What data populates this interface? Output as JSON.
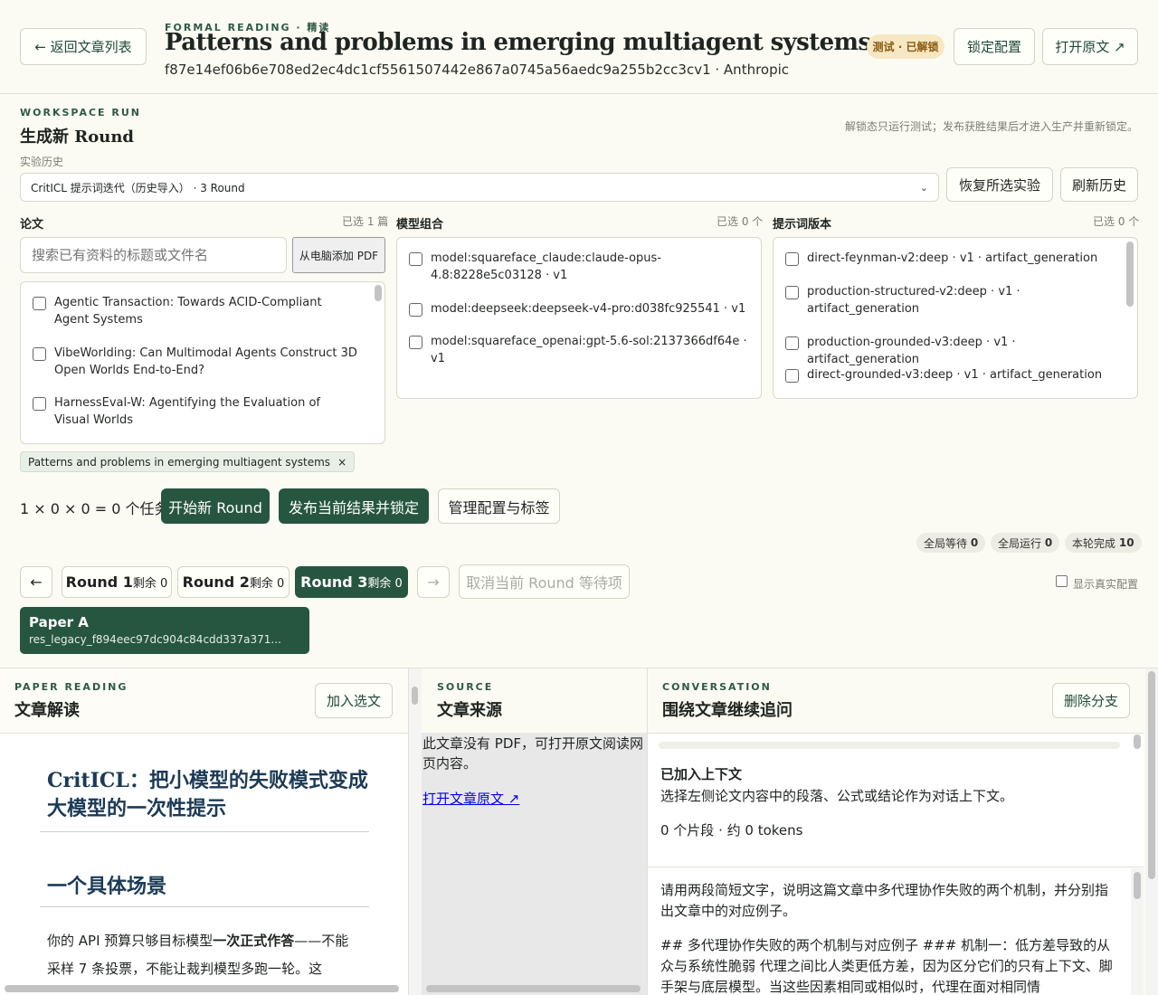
{
  "header": {
    "back_label": "← 返回文章列表",
    "eyebrow": "FORMAL READING · 精读",
    "title": "Patterns and problems in emerging multiagent systems",
    "subtitle": "f87e14ef06b6e708ed2ec4dc1cf5561507442e867a0745a56aedc9a255b2cc3cv1 · Anthropic",
    "status_badge": "测试 · 已解锁",
    "lock_label": "锁定配置",
    "open_label": "打开原文 ↗"
  },
  "workspace": {
    "eyebrow": "WORKSPACE RUN",
    "title": "生成新 Round",
    "note": "解锁态只运行测试；发布获胜结果后才进入生产并重新锁定。",
    "history_label": "实验历史",
    "history_selected": "CritICL 提示词迭代（历史导入） · 3 Round",
    "restore_label": "恢复所选实验",
    "refresh_label": "刷新历史"
  },
  "papers": {
    "label": "论文",
    "count": "已选 1 篇",
    "search_placeholder": "搜索已有资料的标题或文件名",
    "add_pdf_label": "从电脑添加 PDF",
    "items": [
      {
        "text": "Agentic Transaction: Towards ACID-Compliant Agent Systems"
      },
      {
        "text": "VibeWorlding: Can Multimodal Agents Construct 3D Open Worlds End-to-End?"
      },
      {
        "text": "HarnessEval-W: Agentifying the Evaluation of Visual Worlds"
      }
    ],
    "selected_chip": "Patterns and problems in emerging multiagent systems",
    "chip_close": "×"
  },
  "models": {
    "label": "模型组合",
    "count": "已选 0 个",
    "items": [
      {
        "text": "model:squareface_claude:claude-opus-4.8:8228e5c03128 · v1"
      },
      {
        "text": "model:deepseek:deepseek-v4-pro:d038fc925541 · v1"
      },
      {
        "text": "model:squareface_openai:gpt-5.6-sol:2137366df64e · v1"
      }
    ]
  },
  "prompts": {
    "label": "提示词版本",
    "count": "已选 0 个",
    "items": [
      {
        "text": "direct-feynman-v2:deep · v1 · artifact_generation"
      },
      {
        "text": "production-structured-v2:deep · v1 · artifact_generation"
      },
      {
        "text": "production-grounded-v3:deep · v1 · artifact_generation"
      },
      {
        "text": "direct-grounded-v3:deep · v1 · artifact_generation"
      }
    ]
  },
  "actions": {
    "task_formula": "1 × 0 × 0 = 0 个任务",
    "start_label": "开始新 Round",
    "publish_label": "发布当前结果并锁定",
    "manage_label": "管理配置与标签"
  },
  "stats": {
    "global_wait_label": "全局等待",
    "global_wait": "0",
    "global_run_label": "全局运行",
    "global_run": "0",
    "round_done_label": "本轮完成",
    "round_done": "10"
  },
  "rounds": {
    "prev": "←",
    "next": "→",
    "items": [
      {
        "name": "Round 1",
        "remain": "剩余 0"
      },
      {
        "name": "Round 2",
        "remain": "剩余 0"
      },
      {
        "name": "Round 3",
        "remain": "剩余 0"
      }
    ],
    "cancel_label": "取消当前 Round 等待项",
    "show_real_label": "显示真实配置"
  },
  "paper_card": {
    "title": "Paper A",
    "id": "res_legacy_f894eec97dc904c84cdd337a371..."
  },
  "reading": {
    "eyebrow": "PAPER READING",
    "title": "文章解读",
    "add_label": "加入选文",
    "h1": "CritICL：把小模型的失败模式变成大模型的一次性提示",
    "h2": "一个具体场景",
    "para_pre": "你的 API 预算只够目标模型",
    "para_bold": "一次正式作答",
    "para_post": "——不能采样 7 条投票，不能让裁判模型多跑一轮。这"
  },
  "source": {
    "eyebrow": "SOURCE",
    "title": "文章来源",
    "text": "此文章没有 PDF，可打开原文阅读网页内容。",
    "link": "打开文章原文 ↗"
  },
  "conversation": {
    "eyebrow": "CONVERSATION",
    "title": "围绕文章继续追问",
    "delete_label": "删除分支",
    "ctx_title": "已加入上下文",
    "ctx_desc": "选择左侧论文内容中的段落、公式或结论作为对话上下文。",
    "ctx_stats": "0 个片段 · 约 0 tokens",
    "msg1": "请用两段简短文字，说明这篇文章中多代理协作失败的两个机制，并分别指出文章中的对应例子。",
    "msg2": "## 多代理协作失败的两个机制与对应例子 ### 机制一：低方差导致的从众与系统性脆弱 代理之间比人类更低方差，因为区分它们的只有上下文、脚手架与底层模型。当这些因素相同或相似时，代理在面对相同情"
  },
  "colors": {
    "brand_green": "#275640",
    "badge_bg": "#f7e7c2",
    "badge_text": "#8a5a12",
    "heading_navy": "#1b3a56"
  }
}
